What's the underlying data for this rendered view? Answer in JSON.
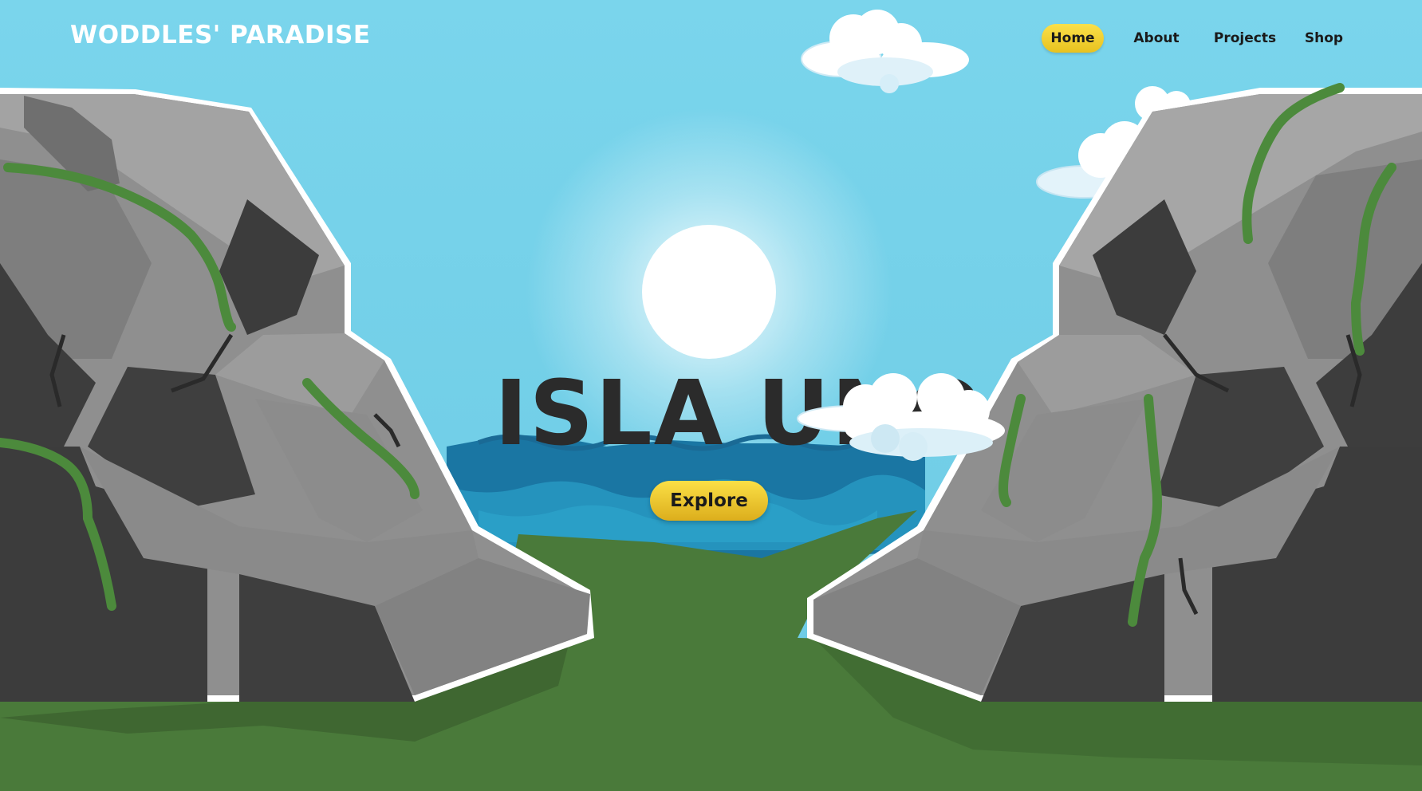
{
  "site": {
    "brand": "WODDLES' PARADISE"
  },
  "nav": {
    "items": [
      {
        "label": "Home",
        "active": true
      },
      {
        "label": "About",
        "active": false
      },
      {
        "label": "Projects",
        "active": false
      },
      {
        "label": "Shop",
        "active": false
      }
    ]
  },
  "hero": {
    "title": "ISLA UNO",
    "cta_label": "Explore"
  },
  "colors": {
    "sky": "#76d2ea",
    "sun": "#ffffff",
    "sea_dark": "#1a76a3",
    "sea_light": "#2a9cc3",
    "grass": "#4a7a3a",
    "grass_dark": "#3a5f2d",
    "rock_light": "#9a9a9a",
    "rock_mid": "#7f7f7f",
    "rock_dark": "#3c3c3c",
    "vine": "#4c8a3c",
    "accent_yellow": "#f5d332"
  },
  "icons": {
    "sun": "sun-icon",
    "cloud": "cloud-icon"
  }
}
